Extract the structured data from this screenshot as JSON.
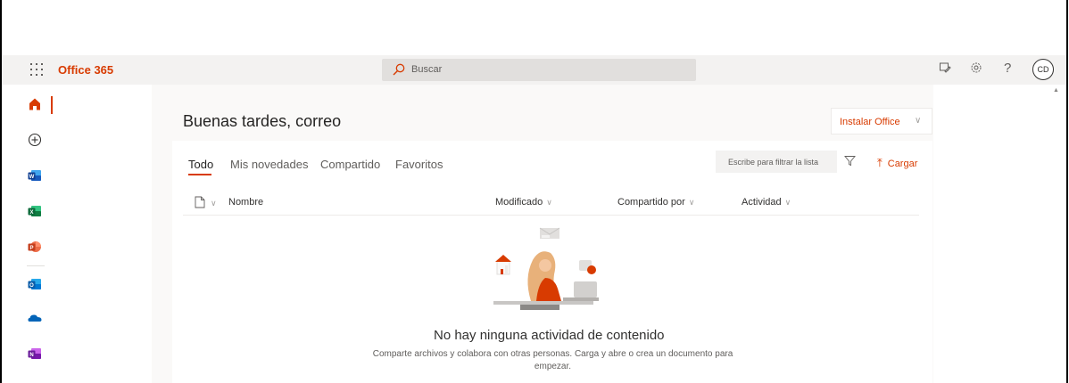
{
  "header": {
    "app_name": "Office 365",
    "search_placeholder": "Buscar",
    "help_label": "?",
    "avatar_initials": "CD"
  },
  "rail": {
    "items": [
      {
        "name": "home",
        "color": "#d83b01"
      },
      {
        "name": "create",
        "color": "#323130"
      },
      {
        "name": "word",
        "color": "#185abd"
      },
      {
        "name": "excel",
        "color": "#107c41"
      },
      {
        "name": "powerpoint",
        "color": "#c43e1c"
      },
      {
        "name": "outlook",
        "color": "#0f6cbd"
      },
      {
        "name": "onedrive",
        "color": "#0364b8"
      },
      {
        "name": "onenote",
        "color": "#7719aa"
      }
    ]
  },
  "main": {
    "greeting": "Buenas tardes, correo",
    "install_label": "Instalar Office",
    "tabs": [
      {
        "label": "Todo",
        "active": true
      },
      {
        "label": "Mis novedades",
        "active": false
      },
      {
        "label": "Compartido",
        "active": false
      },
      {
        "label": "Favoritos",
        "active": false
      }
    ],
    "filter_placeholder": "Escribe para filtrar la lista",
    "upload_label": "Cargar",
    "columns": {
      "name": "Nombre",
      "modified": "Modificado",
      "shared_by": "Compartido por",
      "activity": "Actividad"
    },
    "empty": {
      "title": "No hay ninguna actividad de contenido",
      "description": "Comparte archivos y colabora con otras personas. Carga y abre o crea un documento para empezar."
    }
  },
  "colors": {
    "accent": "#d83b01",
    "header_bg": "#f3f2f1",
    "search_bg": "#e1dfdd"
  }
}
